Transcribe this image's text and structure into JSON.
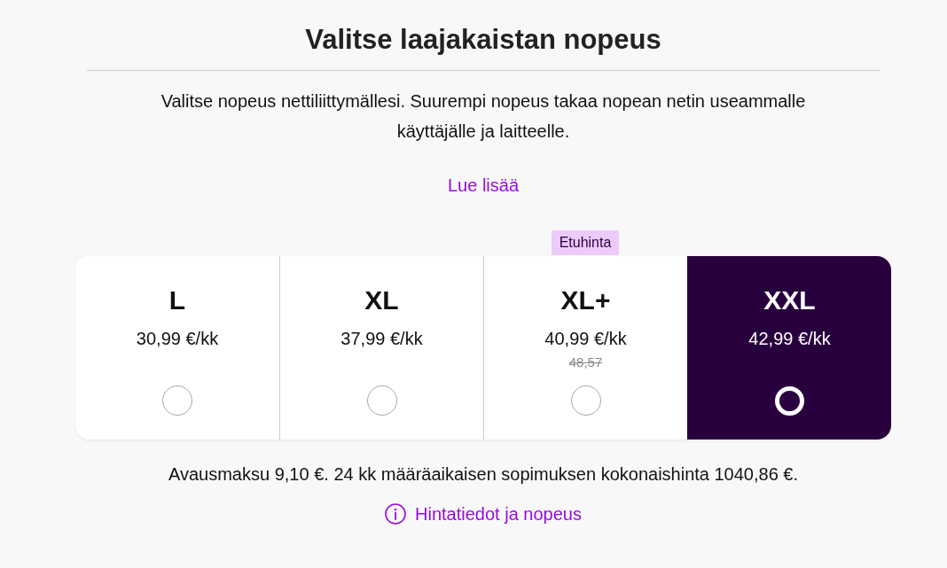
{
  "heading": "Valitse laajakaistan nopeus",
  "intro": "Valitse nopeus nettiliittymällesi. Suurempi nopeus takaa nopean netin useammalle käyttäjälle ja laitteelle.",
  "read_more_link": "Lue lisää",
  "plans": [
    {
      "name": "L",
      "price": "30,99 €/kk",
      "selected": false
    },
    {
      "name": "XL",
      "price": "37,99 €/kk",
      "selected": false
    },
    {
      "name": "XL+",
      "price": "40,99 €/kk",
      "old_price": "48,57",
      "badge": "Etuhinta",
      "selected": false
    },
    {
      "name": "XXL",
      "price": "42,99 €/kk",
      "selected": true
    }
  ],
  "fee_note": "Avausmaksu 9,10 €. 24 kk määräaikaisen sopimuksen kokonaishinta 1040,86 €.",
  "price_info_link": "Hintatiedot ja nopeus"
}
